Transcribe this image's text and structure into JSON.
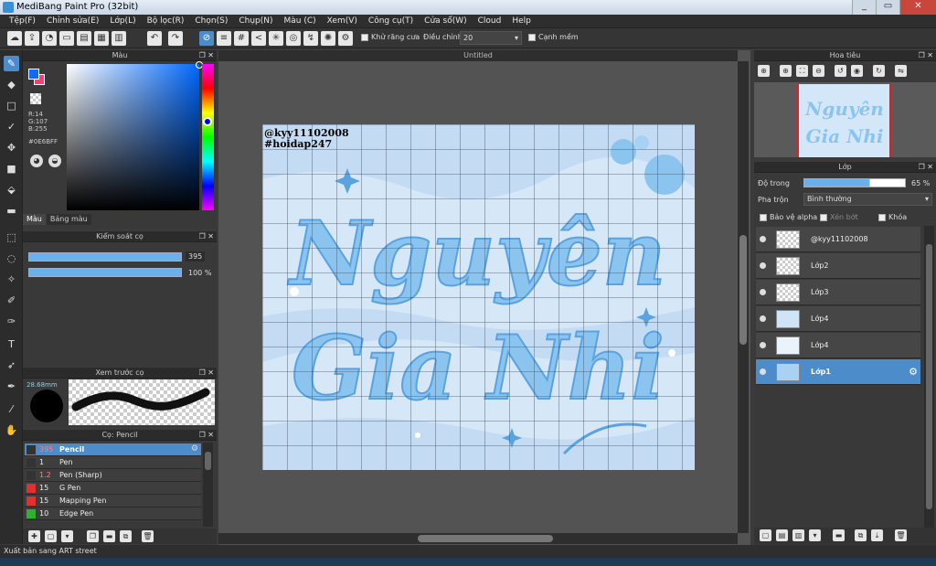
{
  "window": {
    "title": "MediBang Paint Pro (32bit)",
    "min": "_",
    "max": "▭",
    "close": "✕"
  },
  "menu": [
    "Tệp(F)",
    "Chỉnh sửa(E)",
    "Lớp(L)",
    "Bộ lọc(R)",
    "Chọn(S)",
    "Chụp(N)",
    "Màu (C)",
    "Xem(V)",
    "Công cụ(T)",
    "Cửa sổ(W)",
    "Cloud",
    "Help"
  ],
  "toolbar": {
    "antialias_label": "Khử răng cưa",
    "correction_label": "Điều chỉnh",
    "correction_value": "20",
    "edge_label": "Cạnh mềm"
  },
  "color_panel": {
    "title": "Màu",
    "r": "R:14",
    "g": "G:107",
    "b": "B:255",
    "hex": "#0E6BFF",
    "tabs": [
      "Màu",
      "Bảng màu"
    ],
    "fg": "#0e6bff",
    "bg": "#ff3c78"
  },
  "brush_control": {
    "title": "Kiểm soát cọ",
    "size": "395",
    "opacity": "100 %"
  },
  "brush_preview": {
    "title": "Xem trước cọ",
    "size": "28.68mm"
  },
  "brush_list": {
    "title": "Cọ: Pencil",
    "items": [
      {
        "size": "395",
        "name": "Pencil",
        "color": "#333333"
      },
      {
        "size": "1",
        "name": "Pen",
        "color": "#333333"
      },
      {
        "size": "1.2",
        "name": "Pen (Sharp)",
        "color": "#333333"
      },
      {
        "size": "15",
        "name": "G Pen",
        "color": "#e03030"
      },
      {
        "size": "15",
        "name": "Mapping Pen",
        "color": "#e03030"
      },
      {
        "size": "10",
        "name": "Edge Pen",
        "color": "#30b030"
      }
    ]
  },
  "canvas": {
    "tab": "Untitled",
    "watermark1": "@kyy11102008",
    "watermark2": "#hoidap247",
    "line1": "Nguyên",
    "line2": "Gia Nhi"
  },
  "navigator": {
    "title": "Hoa tiêu"
  },
  "layers": {
    "title": "Lớp",
    "opacity_label": "Độ trong",
    "opacity_value": "65 %",
    "blend_label": "Pha trộn",
    "blend_value": "Bình thường",
    "protect_alpha": "Bảo vệ alpha",
    "clipping": "Xén bớt",
    "lock": "Khóa",
    "items": [
      {
        "name": "@kyy11102008"
      },
      {
        "name": "Lớp2"
      },
      {
        "name": "Lớp3"
      },
      {
        "name": "Lớp4"
      },
      {
        "name": "Lớp4"
      },
      {
        "name": "Lớp1"
      }
    ]
  },
  "status": "Xuất bản sang ART street"
}
